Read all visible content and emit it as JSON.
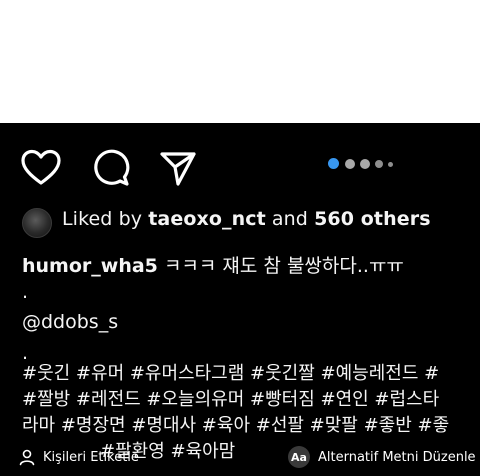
{
  "post": {
    "likes": {
      "prefix": "Liked by",
      "user": "taeoxo_nct",
      "and": "and",
      "others": "560 others"
    },
    "caption": {
      "username": "humor_wha5",
      "text": "ㅋㅋㅋ 쟤도 참 불쌍하다..ㅠㅠ",
      "line2": ".",
      "mention": "@ddobs_s",
      "line4": "."
    },
    "hashtags": [
      "#웃긴 #유머 #유머스타그램 #웃긴짤 #예능레전드 #",
      "#짤방 #레전드 #오늘의유머 #빵터짐 #연인 #럽스타",
      "라마 #명장면 #명대사 #육아 #선팔 #맞팔 #좋반 #좋",
      "#팔환영 #육아맘"
    ],
    "carousel": {
      "dots": 5,
      "active_index": 0,
      "active_color": "#3897f0"
    }
  },
  "bottom_bar": {
    "left_label": "Kişileri Etiketle",
    "right_badge": "Aa",
    "right_label": "Alternatif Metni Düzenle"
  },
  "icons": [
    "heart-icon",
    "comment-icon",
    "share-icon",
    "person-tag-icon"
  ]
}
